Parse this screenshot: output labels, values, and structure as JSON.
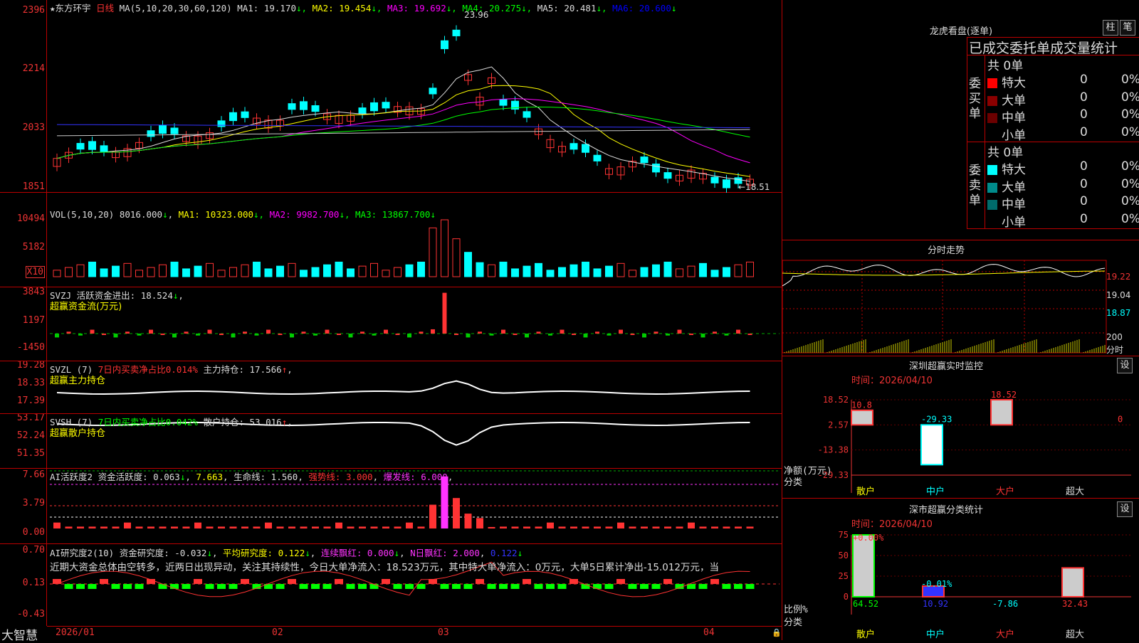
{
  "app": {
    "brand": "大智慧",
    "stock": "★东方环宇",
    "period": "日线"
  },
  "kline": {
    "ma_text": "MA(5,10,20,30,60,120)",
    "ma": [
      {
        "label": "MA1:",
        "value": "19.170",
        "dir": "↓",
        "color": "#dddddd"
      },
      {
        "label": "MA2:",
        "value": "19.454",
        "dir": "↓",
        "color": "#ffff00"
      },
      {
        "label": "MA3:",
        "value": "19.692",
        "dir": "↓",
        "color": "#ff00ff"
      },
      {
        "label": "MA4:",
        "value": "20.275",
        "dir": "↓",
        "color": "#00ff00"
      },
      {
        "label": "MA5:",
        "value": "20.481",
        "dir": "↓",
        "color": "#dddddd"
      },
      {
        "label": "MA6:",
        "value": "20.600",
        "dir": "↓",
        "color": "#0000ff"
      }
    ],
    "yticks": [
      "2396",
      "2214",
      "2033",
      "1851"
    ],
    "high_label": "23.96",
    "low_label": "←18.51"
  },
  "vol": {
    "title": "VOL(5,10,20)",
    "value": "8016.000",
    "ma": [
      {
        "label": "MA1:",
        "value": "10323.000",
        "dir": "↓",
        "color": "#ffff00"
      },
      {
        "label": "MA2:",
        "value": "9982.700",
        "dir": "↓",
        "color": "#ff00ff"
      },
      {
        "label": "MA3:",
        "value": "13867.700",
        "dir": "↓",
        "color": "#00ff00"
      }
    ],
    "yticks": [
      "10494",
      "5182"
    ],
    "unit": "X10"
  },
  "svzj": {
    "title": "SVZJ",
    "label": "活跃资金进出:",
    "value": "18.524",
    "dir": "↓",
    "subtitle": "超赢资金流(万元)",
    "yticks": [
      "3843",
      "1197",
      "-1450"
    ]
  },
  "svzl": {
    "title": "SVZL (7)",
    "ratio": "7日内买卖净占比0.014%",
    "label": "主力持仓:",
    "value": "17.566",
    "dir": "↑",
    "subtitle": "超赢主力持仓",
    "yticks": [
      "19.28",
      "18.33",
      "17.39"
    ]
  },
  "svsh": {
    "title": "SVSH (7)",
    "ratio": "7日内买卖净占比0.042%",
    "label": "散户持仓:",
    "value": "53.016",
    "dir": "↑",
    "subtitle": "超赢散户持仓",
    "yticks": [
      "53.17",
      "52.24",
      "51.35"
    ]
  },
  "ai1": {
    "title": "AI活跃度2",
    "a_label": "资金活跃度:",
    "a_value": "0.063",
    "a_dir": "↓",
    "b_value": "7.663",
    "c_label": "生命线:",
    "c_value": "1.560",
    "d_label": "强势线:",
    "d_value": "3.000",
    "e_label": "爆发线:",
    "e_value": "6.000",
    "yticks": [
      "7.66",
      "3.79",
      "0.00"
    ]
  },
  "ai2": {
    "title": "AI研究度2(10)",
    "a_label": "资金研究度:",
    "a_value": "-0.032",
    "a_dir": "↓",
    "b_label": "平均研究度:",
    "b_value": "0.122",
    "b_dir": "↓",
    "c_label": "连续飘红:",
    "c_value": "0.000",
    "c_dir": "↓",
    "d_label": "N日飘红:",
    "d_value": "2.000",
    "e_value": "0.122",
    "e_dir": "↓",
    "comment": "近期大资金总体由空转多，近两日出现异动，关注其持续性，今日大单净流入：18.523万元，其中特大单净流入：0万元，大单5日累计净出-15.012万元，当",
    "yticks": [
      "0.70",
      "0.13",
      "-0.43"
    ]
  },
  "dates": [
    "2026/01",
    "02",
    "03",
    "04"
  ],
  "longhu": {
    "title": "龙虎看盘(逐单)",
    "btn1": "柱",
    "btn2": "笔",
    "header": "已成交委托单成交量统计",
    "buy_label": "委买单",
    "sell_label": "委卖单",
    "buy_total": "共 0单",
    "sell_total": "共 0单",
    "buy": [
      {
        "name": "特大",
        "count": "0",
        "pct": "0%",
        "color": "#ff0000"
      },
      {
        "name": "大单",
        "count": "0",
        "pct": "0%",
        "color": "#8b0000"
      },
      {
        "name": "中单",
        "count": "0",
        "pct": "0%",
        "color": "#6b0000"
      },
      {
        "name": "小单",
        "count": "0",
        "pct": "0%",
        "color": "#000000"
      }
    ],
    "sell": [
      {
        "name": "特大",
        "count": "0",
        "pct": "0%",
        "color": "#00ffff"
      },
      {
        "name": "大单",
        "count": "0",
        "pct": "0%",
        "color": "#008b8b"
      },
      {
        "name": "中单",
        "count": "0",
        "pct": "0%",
        "color": "#006b6b"
      },
      {
        "name": "小单",
        "count": "0",
        "pct": "0%",
        "color": "#000000"
      }
    ]
  },
  "intraday": {
    "title": "分时走势",
    "prices": [
      "19.22",
      "19.04",
      "18.87"
    ],
    "vol": "200",
    "vol_unit": "分时"
  },
  "szmon": {
    "title": "深圳超赢实时监控",
    "btn": "设",
    "time": "时间：2026/04/10",
    "yticks": [
      "18.52",
      "2.57",
      "-13.38",
      "-29.33"
    ],
    "y_unit": "净额(万元)",
    "x_unit": "分类",
    "categories": [
      "散户",
      "中户",
      "大户",
      "超大"
    ],
    "values": [
      "10.8",
      "-29.33",
      "18.52",
      "0"
    ]
  },
  "szcls": {
    "title": "深市超赢分类统计",
    "btn": "设",
    "time": "时间：2026/04/10",
    "yticks": [
      "75",
      "50",
      "25",
      "0"
    ],
    "y_unit": "比例%",
    "x_unit": "分类",
    "categories": [
      "散户",
      "中户",
      "大户",
      "超大"
    ],
    "bottom_values": [
      "64.52",
      "10.92",
      "-7.86",
      "32.43"
    ],
    "top_labels": [
      "+0.00%",
      "-0.01%"
    ]
  }
}
